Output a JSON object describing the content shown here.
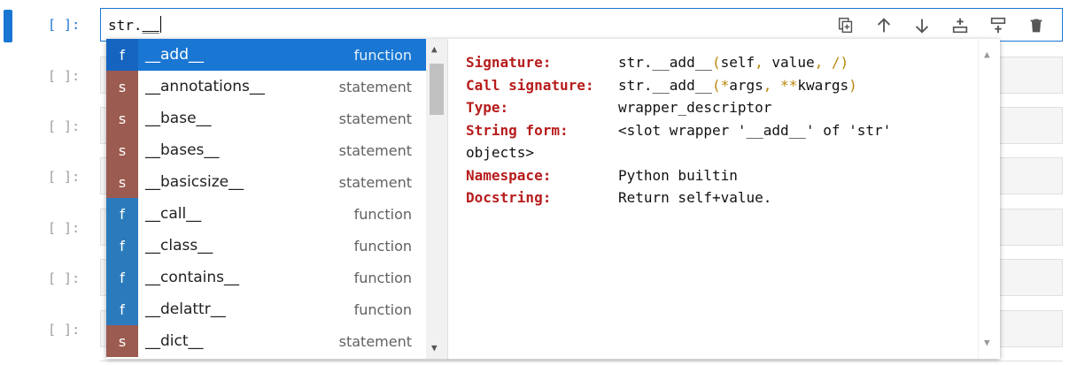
{
  "active_cell": {
    "prompt": "[ ]:",
    "code_prefix": "str.",
    "code_underscores": "__"
  },
  "cells": [
    {
      "prompt": "[ ]:"
    },
    {
      "prompt": "[ ]:"
    },
    {
      "prompt": "[ ]:"
    },
    {
      "prompt": "[ ]:"
    },
    {
      "prompt": "[ ]:"
    },
    {
      "prompt": "[ ]:"
    }
  ],
  "toolbar": {
    "icons": [
      "duplicate-icon",
      "move-up-icon",
      "move-down-icon",
      "insert-above-icon",
      "insert-below-icon",
      "delete-icon"
    ]
  },
  "completer": {
    "items": [
      {
        "badge": "f",
        "name": "__add__",
        "type": "function",
        "selected": true
      },
      {
        "badge": "s",
        "name": "__annotations__",
        "type": "statement"
      },
      {
        "badge": "s",
        "name": "__base__",
        "type": "statement"
      },
      {
        "badge": "s",
        "name": "__bases__",
        "type": "statement"
      },
      {
        "badge": "s",
        "name": "__basicsize__",
        "type": "statement"
      },
      {
        "badge": "f",
        "name": "__call__",
        "type": "function"
      },
      {
        "badge": "f",
        "name": "__class__",
        "type": "function"
      },
      {
        "badge": "f",
        "name": "__contains__",
        "type": "function"
      },
      {
        "badge": "f",
        "name": "__delattr__",
        "type": "function"
      },
      {
        "badge": "s",
        "name": "__dict__",
        "type": "statement"
      }
    ],
    "docs": {
      "signature_label": "Signature:",
      "signature_a": "str.__add__",
      "signature_p1": "(",
      "signature_b": "self",
      "signature_c1": ",",
      "signature_d": " value",
      "signature_c2": ",",
      "signature_e": " /",
      "signature_p2": ")",
      "call_label": "Call signature:",
      "call_a": "str.__add__",
      "call_p1": "(",
      "call_b": "*",
      "call_c": "args",
      "call_d": ",",
      "call_e": " **",
      "call_f": "kwargs",
      "call_p2": ")",
      "type_label": "Type:",
      "type_value": "wrapper_descriptor",
      "string_form_label": "String form:",
      "string_form_value": "<slot wrapper '__add__' of 'str'",
      "string_form_cont": "objects>",
      "namespace_label": "Namespace:",
      "namespace_value": "Python builtin",
      "docstring_label": "Docstring:",
      "docstring_value": "Return self+value."
    }
  },
  "colors": {
    "accent": "#1976d2",
    "function_badge": "#2b7bbc",
    "statement_badge": "#9c5b50",
    "doc_key": "#b71c1c"
  }
}
